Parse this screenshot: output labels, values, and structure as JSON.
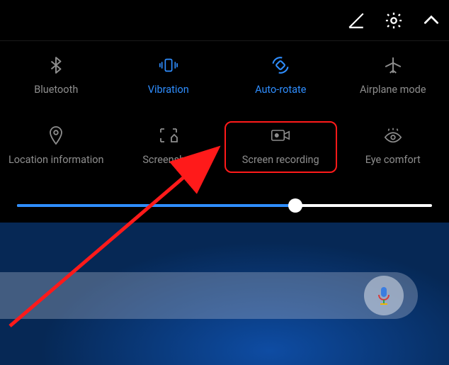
{
  "topbar": {
    "edit_icon": "edit-icon",
    "settings_icon": "settings-icon",
    "expand_icon": "chevron-up-icon"
  },
  "tiles": [
    {
      "id": "bluetooth",
      "label": "Bluetooth",
      "active": false
    },
    {
      "id": "vibration",
      "label": "Vibration",
      "active": true
    },
    {
      "id": "autorotate",
      "label": "Auto-rotate",
      "active": true
    },
    {
      "id": "airplane",
      "label": "Airplane mode",
      "active": false
    },
    {
      "id": "location",
      "label": "Location information",
      "active": false
    },
    {
      "id": "screenshot",
      "label": "Screenshot",
      "active": false
    },
    {
      "id": "screenrecord",
      "label": "Screen recording",
      "active": false,
      "highlighted": true
    },
    {
      "id": "eyecomfort",
      "label": "Eye comfort",
      "active": false
    }
  ],
  "brightness": {
    "percent": 67
  },
  "searchbar": {
    "mic_icon": "microphone-icon"
  },
  "annotation": {
    "color": "#ff1a1a"
  }
}
